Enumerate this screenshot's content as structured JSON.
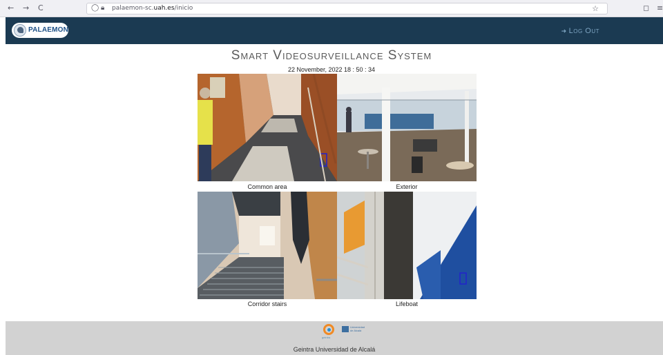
{
  "browser": {
    "back": "←",
    "forward": "→",
    "reload": "C",
    "url_prefix": "palaemon-sc.",
    "url_domain": "uah.es",
    "url_path": "/inicio",
    "shield": "◻",
    "menu": "≡"
  },
  "header": {
    "logo_text": "PALAEMON",
    "logout_label": "Log Out"
  },
  "main": {
    "title": "Smart Videosurveillance System",
    "datetime": "22 November, 2022 18 : 50 : 34",
    "cameras": [
      {
        "label": "Common area"
      },
      {
        "label": "Exterior"
      },
      {
        "label": "Corridor stairs"
      },
      {
        "label": "Lifeboat"
      }
    ]
  },
  "footer": {
    "logo1_caption": "geintra",
    "logo2_caption_1": "Universidad",
    "logo2_caption_2": "de Alcalá",
    "text": "Geintra   Universidad de Alcalá"
  },
  "colors": {
    "header_bg": "#1b3a52",
    "logout": "#7fa6c3",
    "footer_bg": "#d2d2d2"
  }
}
